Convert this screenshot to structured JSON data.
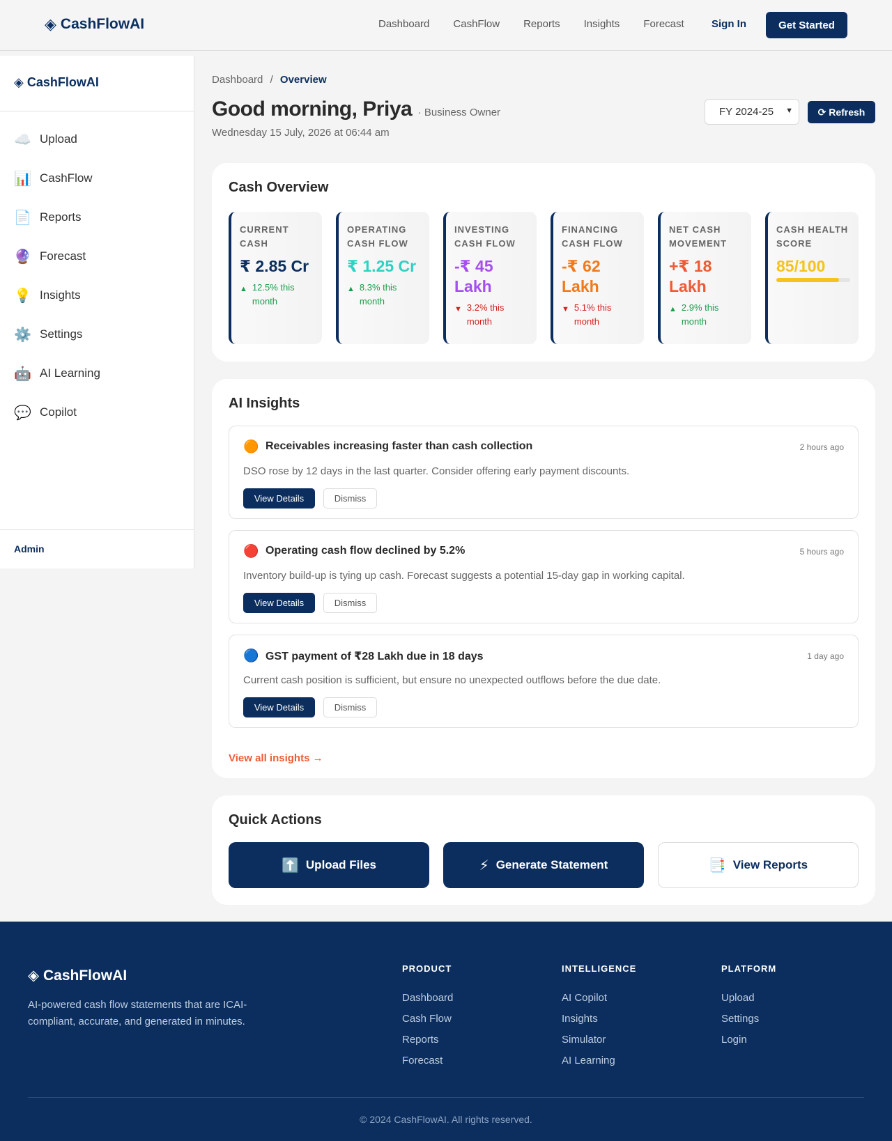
{
  "topnav": {
    "brand": "CashFlowAI",
    "links": [
      "Dashboard",
      "CashFlow",
      "Reports",
      "Insights",
      "Forecast"
    ],
    "signin": "Sign In",
    "get_started": "Get Started"
  },
  "sidebar": {
    "brand": "CashFlowAI",
    "items": [
      {
        "label": "Upload",
        "icon": "☁️"
      },
      {
        "label": "CashFlow",
        "icon": "📊"
      },
      {
        "label": "Reports",
        "icon": "📄"
      },
      {
        "label": "Forecast",
        "icon": "🔮"
      },
      {
        "label": "Insights",
        "icon": "💡"
      },
      {
        "label": "Settings",
        "icon": "⚙️"
      },
      {
        "label": "AI Learning",
        "icon": "🤖"
      },
      {
        "label": "Copilot",
        "icon": "💬"
      }
    ],
    "admin": "Admin"
  },
  "header": {
    "breadcrumb_root": "Dashboard",
    "breadcrumb_sep": "/",
    "breadcrumb_current": "Overview",
    "greeting": "Good morning, Priya",
    "role": "· Business Owner",
    "date": "Wednesday 15 July, 2026 at 06:44 am",
    "fy_selected": "FY 2024-25",
    "refresh": "⟳ Refresh"
  },
  "overview": {
    "title": "Cash Overview",
    "stats": [
      {
        "label": "Current Cash",
        "value": "₹ 2.85 Cr",
        "change": "12.5% this month",
        "dir": "up",
        "color": "#0b2e5e"
      },
      {
        "label": "Operating Cash Flow",
        "value": "₹ 1.25 Cr",
        "change": "8.3% this month",
        "dir": "up",
        "color": "#2fd1c3"
      },
      {
        "label": "Investing Cash Flow",
        "value": "-₹ 45 Lakh",
        "change": "3.2% this month",
        "dir": "down",
        "color": "#a64ff0"
      },
      {
        "label": "Financing Cash Flow",
        "value": "-₹ 62 Lakh",
        "change": "5.1% this month",
        "dir": "down",
        "color": "#f07a1c"
      },
      {
        "label": "Net Cash Movement",
        "value": "+₹ 18 Lakh",
        "change": "2.9% this month",
        "dir": "up",
        "color": "#ee5a36"
      },
      {
        "label": "Cash Health Score",
        "value": "85/100",
        "score": 85,
        "color": "#f5c31c"
      }
    ]
  },
  "insights": {
    "title": "AI Insights",
    "items": [
      {
        "dot": "🟠",
        "title": "Receivables increasing faster than cash collection",
        "time": "2 hours ago",
        "desc": "DSO rose by 12 days in the last quarter. Consider offering early payment discounts."
      },
      {
        "dot": "🔴",
        "title": "Operating cash flow declined by 5.2%",
        "time": "5 hours ago",
        "desc": "Inventory build-up is tying up cash. Forecast suggests a potential 15-day gap in working capital."
      },
      {
        "dot": "🔵",
        "title": "GST payment of ₹28 Lakh due in 18 days",
        "time": "1 day ago",
        "desc": "Current cash position is sufficient, but ensure no unexpected outflows before the due date."
      }
    ],
    "view_details": "View Details",
    "dismiss": "Dismiss",
    "view_all": "View all insights →"
  },
  "quick_actions": {
    "title": "Quick Actions",
    "items": [
      {
        "icon": "⬆️",
        "label": "Upload Files"
      },
      {
        "icon": "⚡",
        "label": "Generate Statement"
      },
      {
        "icon": "📑",
        "label": "View Reports"
      }
    ]
  },
  "footer": {
    "brand": "CashFlowAI",
    "tagline": "AI-powered cash flow statements that are ICAI-compliant, accurate, and generated in minutes.",
    "columns": [
      {
        "heading": "PRODUCT",
        "links": [
          "Dashboard",
          "Cash Flow",
          "Reports",
          "Forecast"
        ]
      },
      {
        "heading": "INTELLIGENCE",
        "links": [
          "AI Copilot",
          "Insights",
          "Simulator",
          "AI Learning"
        ]
      },
      {
        "heading": "PLATFORM",
        "links": [
          "Upload",
          "Settings",
          "Login"
        ]
      }
    ],
    "copyright": "© 2024 CashFlowAI. All rights reserved."
  }
}
